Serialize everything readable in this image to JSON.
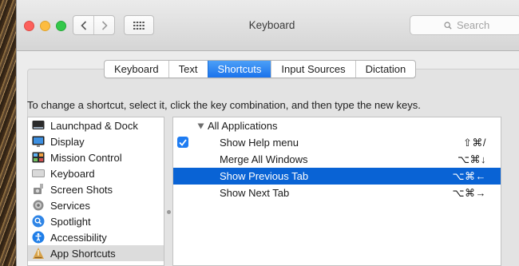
{
  "window": {
    "title": "Keyboard",
    "search_placeholder": "Search"
  },
  "icons": {
    "back": "chevron-left-icon",
    "forward": "chevron-right-icon",
    "show_all": "grid-icon",
    "search": "search-icon"
  },
  "tabs": [
    {
      "label": "Keyboard",
      "active": false
    },
    {
      "label": "Text",
      "active": false
    },
    {
      "label": "Shortcuts",
      "active": true
    },
    {
      "label": "Input Sources",
      "active": false
    },
    {
      "label": "Dictation",
      "active": false
    }
  ],
  "instructions": "To change a shortcut, select it, click the key combination, and then type the new keys.",
  "categories": [
    {
      "label": "Launchpad & Dock",
      "icon": "launchpad-icon"
    },
    {
      "label": "Display",
      "icon": "display-icon"
    },
    {
      "label": "Mission Control",
      "icon": "mission-control-icon"
    },
    {
      "label": "Keyboard",
      "icon": "keyboard-icon"
    },
    {
      "label": "Screen Shots",
      "icon": "screenshot-icon"
    },
    {
      "label": "Services",
      "icon": "services-gear-icon"
    },
    {
      "label": "Spotlight",
      "icon": "spotlight-icon"
    },
    {
      "label": "Accessibility",
      "icon": "accessibility-icon"
    },
    {
      "label": "App Shortcuts",
      "icon": "app-shortcuts-icon",
      "selected": true
    }
  ],
  "shortcuts": {
    "group_label": "All Applications",
    "rows": [
      {
        "label": "Show Help menu",
        "keys": "⇧⌘/",
        "checked": true
      },
      {
        "label": "Merge All Windows",
        "keys": "⌥⌘↓"
      },
      {
        "label": "Show Previous Tab",
        "keys": "⌥⌘←",
        "selected": true
      },
      {
        "label": "Show Next Tab",
        "keys": "⌥⌘→"
      }
    ]
  },
  "colors": {
    "accent": "#1a73ec",
    "selection": "#0963d5"
  }
}
